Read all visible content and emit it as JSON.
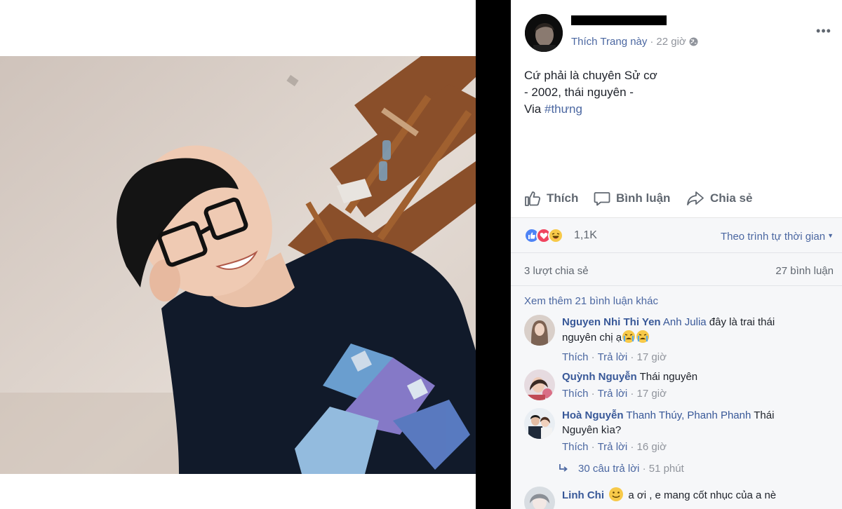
{
  "post": {
    "meta": {
      "like_page": "Thích Trang này",
      "separator": "·",
      "time": "22 giờ"
    },
    "text_lines": [
      "Cứ phải là chuyên Sử cơ",
      "- 2002, thái nguyên -"
    ],
    "via_prefix": "Via ",
    "hashtag": "#thưng",
    "actions": {
      "like": "Thích",
      "comment": "Bình luận",
      "share": "Chia sẻ"
    }
  },
  "stats": {
    "reaction_count": "1,1K",
    "sort_order": "Theo trình tự thời gian",
    "shares": "3 lượt chia sẻ",
    "comments": "27 bình luận",
    "reaction_types": [
      "like-icon",
      "love-icon",
      "haha-icon"
    ]
  },
  "comments": {
    "view_more": "Xem thêm 21 bình luận khác",
    "items": [
      {
        "author": "Nguyen Nhi Thi Yen",
        "tag": "Anh Julia",
        "text": " đây là trai thái nguyên chị ạ",
        "like": "Thích",
        "reply": "Trả lời",
        "time": "17 giờ"
      },
      {
        "author": "Quỳnh Nguyễn",
        "text": " Thái nguyên",
        "like": "Thích",
        "reply": "Trả lời",
        "time": "17 giờ"
      },
      {
        "author": "Hoà Nguyễn",
        "tag": "Thanh Thúy, Phanh Phanh",
        "text": " Thái Nguyên kìa?",
        "like": "Thích",
        "reply": "Trả lời",
        "time": "16 giờ"
      },
      {
        "author": "Linh Chi",
        "text": "a ơi , e mang cốt nhục của a nè"
      }
    ],
    "replies": {
      "label": "30 câu trả lời",
      "separator": "·",
      "time": "51 phút"
    }
  },
  "colors": {
    "link_blue": "#4b67a1",
    "name_blue": "#385898",
    "meta_gray": "#90949c",
    "action_gray": "#606770",
    "like_blue": "#4e83f5",
    "love_red": "#f0445e",
    "haha_yellow": "#f7c949"
  }
}
